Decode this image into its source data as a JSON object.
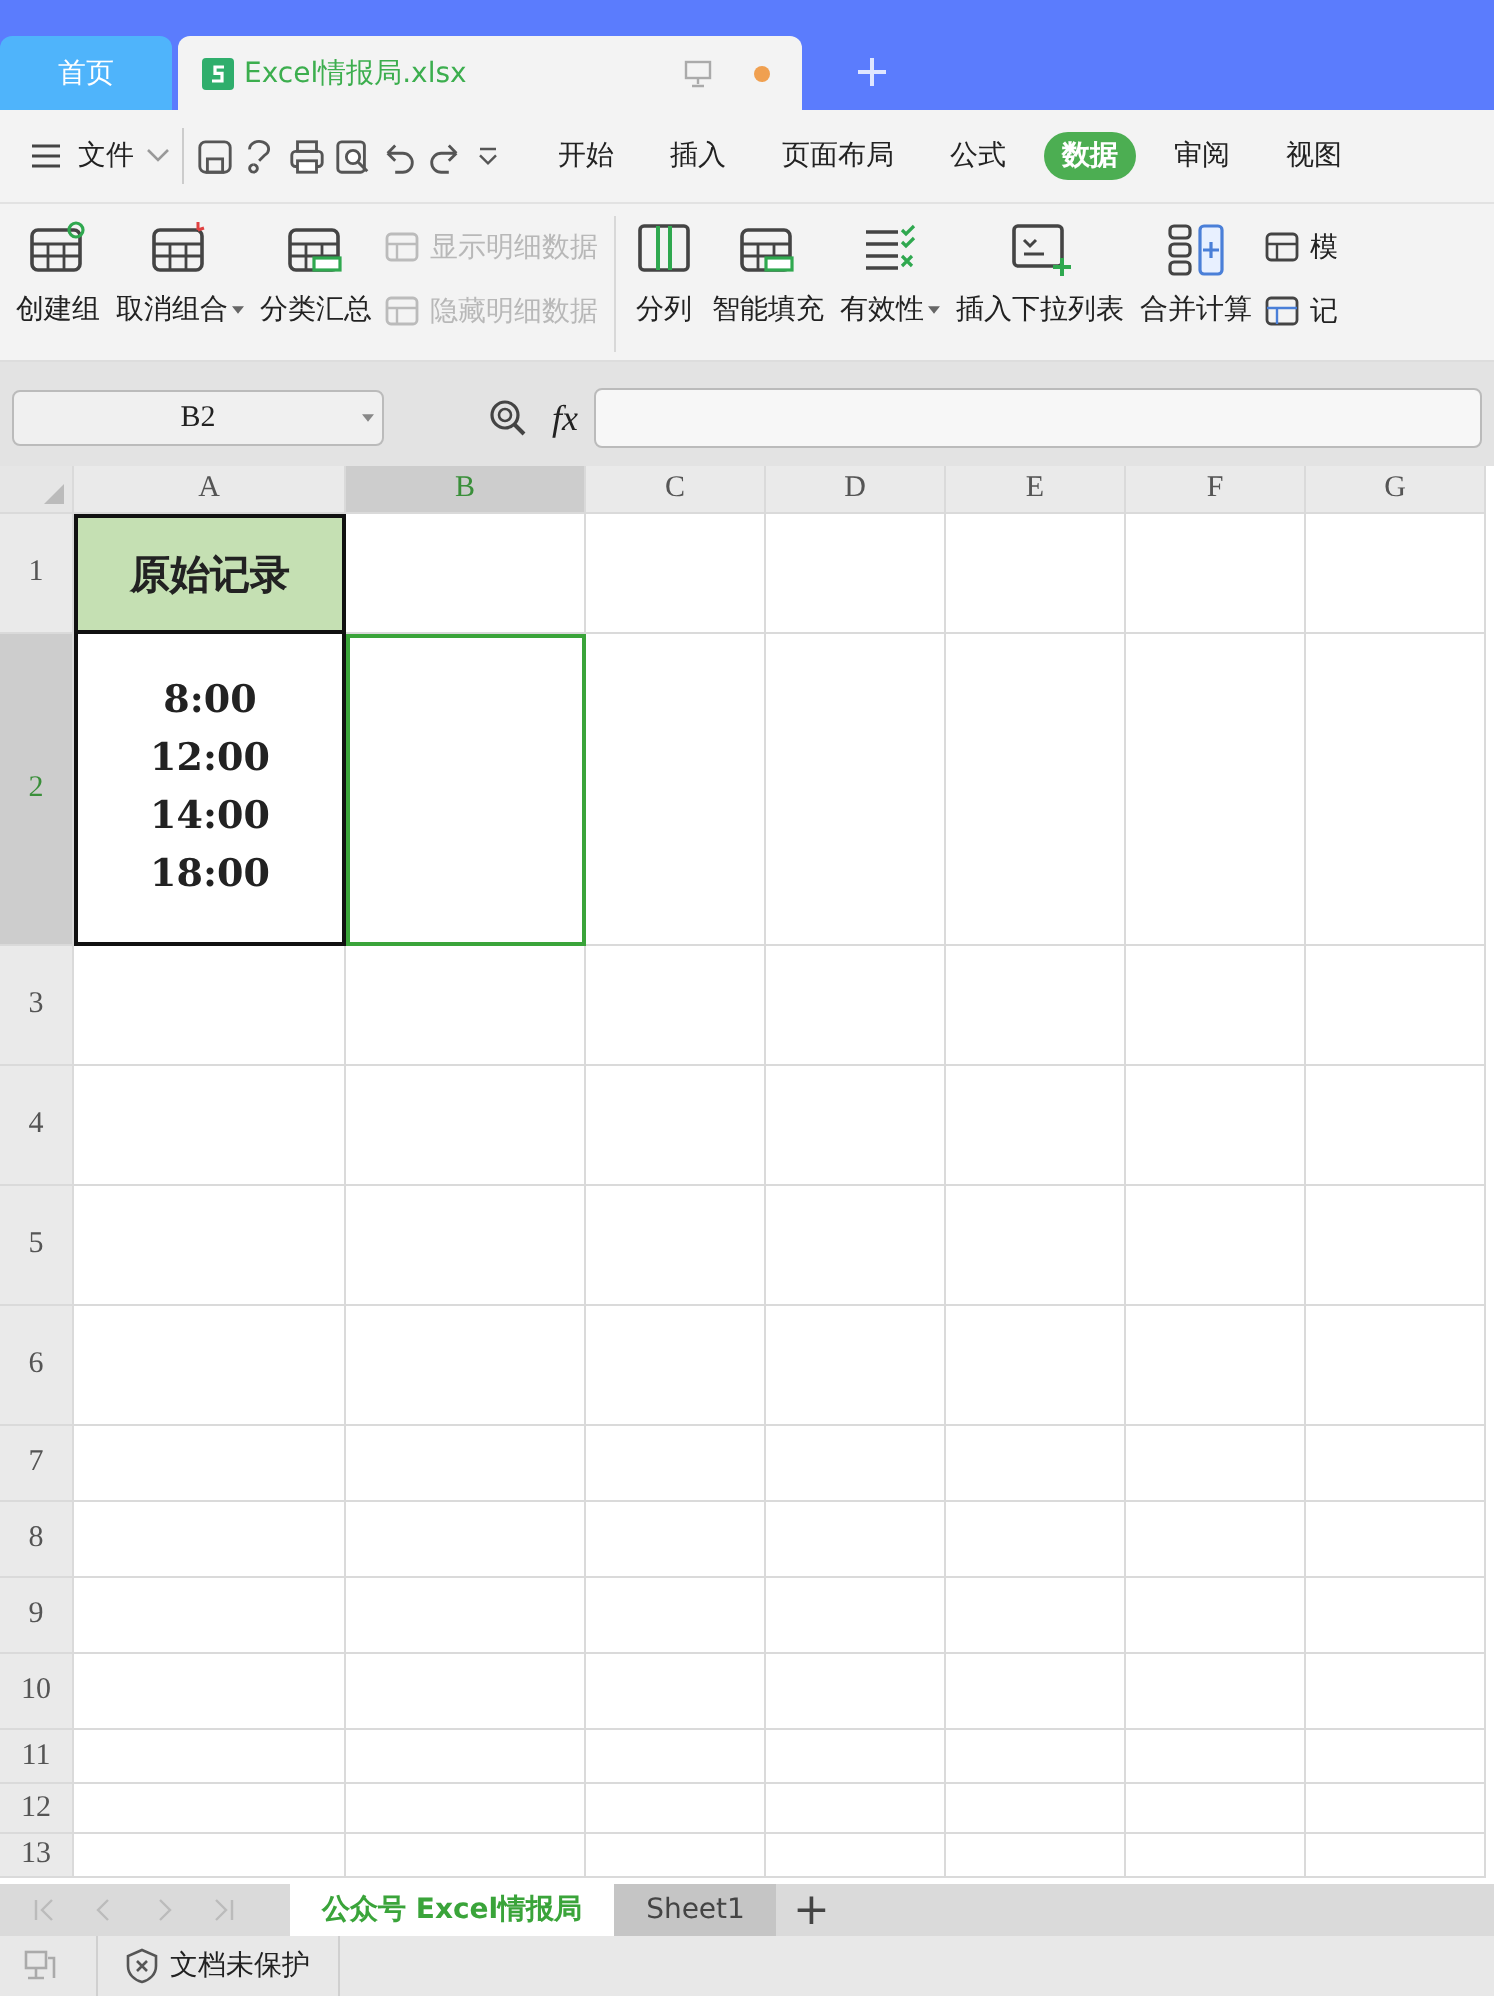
{
  "title_tabs": [
    {
      "label": "首页",
      "selected": false,
      "unsaved": false
    },
    {
      "label": "Excel情报局.xlsx",
      "selected": true,
      "unsaved": true
    }
  ],
  "menu": {
    "file": "文件",
    "tabs": [
      {
        "label": "开始",
        "selected": false
      },
      {
        "label": "插入",
        "selected": false
      },
      {
        "label": "页面布局",
        "selected": false
      },
      {
        "label": "公式",
        "selected": false
      },
      {
        "label": "数据",
        "selected": true
      },
      {
        "label": "审阅",
        "selected": false
      },
      {
        "label": "视图",
        "selected": false
      }
    ]
  },
  "ribbon": {
    "groups": [
      {
        "items": [
          {
            "kind": "large",
            "label": "创建组",
            "dropdown": false,
            "disabled": false
          },
          {
            "kind": "large",
            "label": "取消组合",
            "dropdown": true,
            "disabled": false
          },
          {
            "kind": "large",
            "label": "分类汇总",
            "dropdown": false,
            "disabled": false
          },
          {
            "kind": "small",
            "label": "显示明细数据",
            "dropdown": false,
            "disabled": true
          },
          {
            "kind": "small",
            "label": "隐藏明细数据",
            "dropdown": false,
            "disabled": true
          }
        ]
      },
      {
        "items": [
          {
            "kind": "large",
            "label": "分列",
            "dropdown": false,
            "disabled": false
          },
          {
            "kind": "large",
            "label": "智能填充",
            "dropdown": false,
            "disabled": false
          },
          {
            "kind": "large",
            "label": "有效性",
            "dropdown": true,
            "disabled": false
          },
          {
            "kind": "large",
            "label": "插入下拉列表",
            "dropdown": false,
            "disabled": false
          },
          {
            "kind": "large",
            "label": "合并计算",
            "dropdown": false,
            "disabled": false
          },
          {
            "kind": "small",
            "label": "模",
            "dropdown": false,
            "disabled": false
          },
          {
            "kind": "small",
            "label": "记",
            "dropdown": false,
            "disabled": false
          }
        ]
      }
    ]
  },
  "formula_bar": {
    "name_box": "B2",
    "fx": "fx"
  },
  "sheet": {
    "columns": [
      {
        "label": "A",
        "selected": false
      },
      {
        "label": "B",
        "selected": true
      },
      {
        "label": "C",
        "selected": false
      },
      {
        "label": "D",
        "selected": false
      },
      {
        "label": "E",
        "selected": false
      },
      {
        "label": "F",
        "selected": false
      },
      {
        "label": "G",
        "selected": false
      }
    ],
    "rows": [
      {
        "label": "1",
        "selected": false,
        "cells": [
          {
            "kind": "header",
            "text": "原始记录"
          }
        ]
      },
      {
        "label": "2",
        "selected": true,
        "cells": [
          {
            "kind": "list",
            "lines": [
              "8:00",
              "12:00",
              "14:00",
              "18:00"
            ]
          }
        ]
      },
      {
        "label": "3",
        "selected": false,
        "cells": []
      },
      {
        "label": "4",
        "selected": false,
        "cells": []
      },
      {
        "label": "5",
        "selected": false,
        "cells": []
      },
      {
        "label": "6",
        "selected": false,
        "cells": []
      },
      {
        "label": "7",
        "selected": false,
        "cells": []
      },
      {
        "label": "8",
        "selected": false,
        "cells": []
      },
      {
        "label": "9",
        "selected": false,
        "cells": []
      },
      {
        "label": "10",
        "selected": false,
        "cells": []
      },
      {
        "label": "11",
        "selected": false,
        "cells": []
      },
      {
        "label": "12",
        "selected": false,
        "cells": []
      },
      {
        "label": "13",
        "selected": false,
        "cells": []
      }
    ]
  },
  "sheet_tabs": [
    {
      "label": "公众号 Excel情报局",
      "selected": true
    },
    {
      "label": "Sheet1",
      "selected": false
    }
  ],
  "add_sheet": "+",
  "status_bar": {
    "protection": "文档未保护"
  }
}
